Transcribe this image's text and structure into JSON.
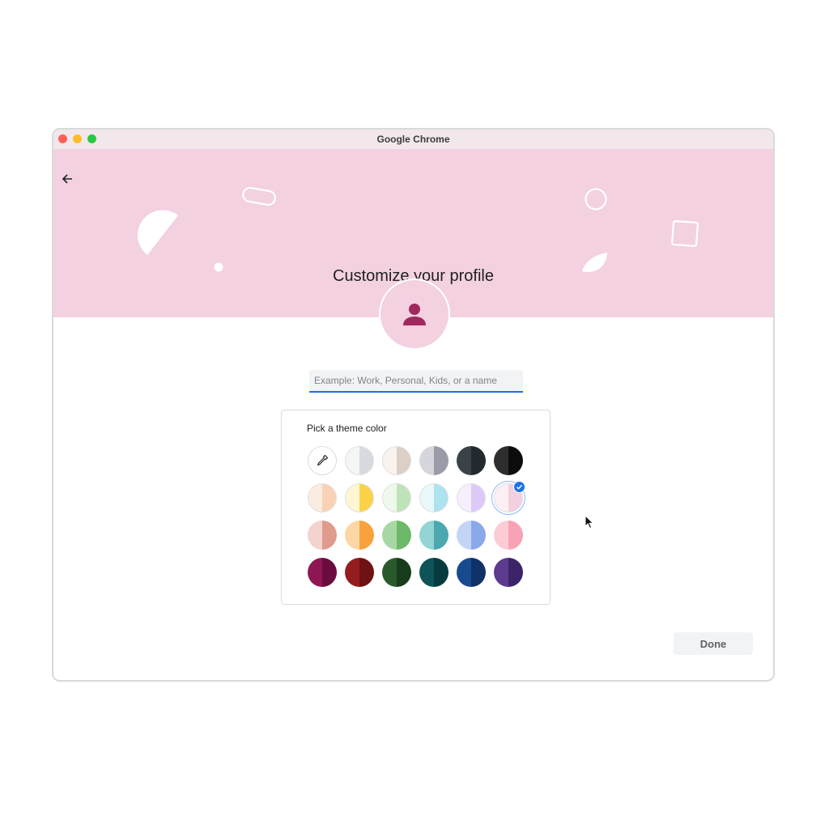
{
  "window": {
    "title": "Google Chrome"
  },
  "header": {
    "title": "Customize your profile"
  },
  "name_input": {
    "value": "",
    "placeholder": "Example: Work, Personal, Kids, or a name"
  },
  "theme_picker": {
    "heading": "Pick a theme color",
    "selected": "light-pink",
    "swatches": [
      {
        "id": "custom",
        "type": "eyedropper"
      },
      {
        "id": "light-grey",
        "left": "#f4f5f6",
        "right": "#d7dbe0"
      },
      {
        "id": "beige",
        "left": "#f8f3ef",
        "right": "#dccfc6"
      },
      {
        "id": "grey",
        "left": "#d5d6db",
        "right": "#9a9ca8"
      },
      {
        "id": "dark-slate",
        "left": "#3a4347",
        "right": "#232a2e"
      },
      {
        "id": "black",
        "left": "#2d2d2d",
        "right": "#0c0c0c"
      },
      {
        "id": "light-peach",
        "left": "#fbece1",
        "right": "#f9d2b5"
      },
      {
        "id": "yellow",
        "left": "#fdf6d0",
        "right": "#fbd248"
      },
      {
        "id": "light-green",
        "left": "#eef8ec",
        "right": "#bfe3b8"
      },
      {
        "id": "light-cyan",
        "left": "#e9f8fb",
        "right": "#ade3ee"
      },
      {
        "id": "lavender",
        "left": "#f6effd",
        "right": "#dcc9fa"
      },
      {
        "id": "light-pink",
        "left": "#fdf0f5",
        "right": "#f3cfe0"
      },
      {
        "id": "salmon",
        "left": "#f2d3ce",
        "right": "#df9b8c"
      },
      {
        "id": "orange",
        "left": "#fcd7a4",
        "right": "#f9a23c"
      },
      {
        "id": "green",
        "left": "#a9d7a4",
        "right": "#6cba69"
      },
      {
        "id": "teal",
        "left": "#93d4d5",
        "right": "#4aa8ae"
      },
      {
        "id": "periwinkle",
        "left": "#c2d5f6",
        "right": "#89a9e9"
      },
      {
        "id": "pink",
        "left": "#fbccd6",
        "right": "#f7a3b5"
      },
      {
        "id": "magenta",
        "left": "#8e1753",
        "right": "#6b0c3e"
      },
      {
        "id": "red",
        "left": "#951c1f",
        "right": "#6e1214"
      },
      {
        "id": "forest",
        "left": "#2a5a2c",
        "right": "#183c1b"
      },
      {
        "id": "dark-teal",
        "left": "#0d5357",
        "right": "#063a3d"
      },
      {
        "id": "navy",
        "left": "#184a8f",
        "right": "#0f3166"
      },
      {
        "id": "purple",
        "left": "#5c3a8e",
        "right": "#3c2468"
      }
    ]
  },
  "footer": {
    "done_label": "Done"
  },
  "colors": {
    "banner": "#f3d1e1",
    "avatar_icon": "#a1285c",
    "accent": "#1a73e8"
  }
}
